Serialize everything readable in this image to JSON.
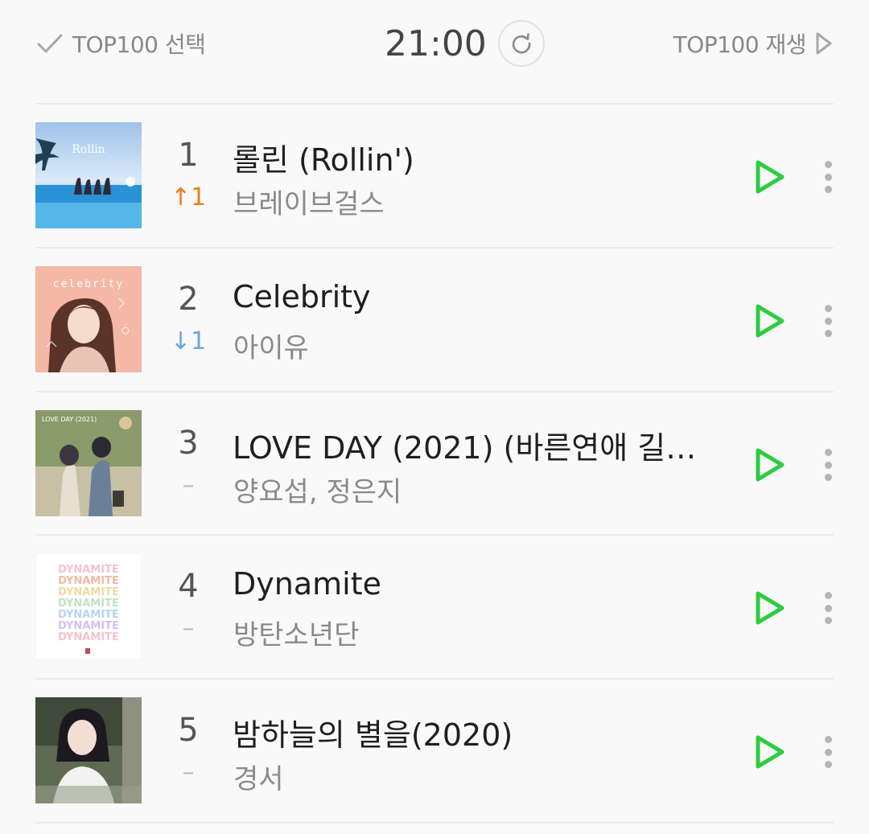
{
  "header": {
    "select_label": "TOP100 선택",
    "time": "21:00",
    "play_all_label": "TOP100 재생"
  },
  "songs": [
    {
      "rank": "1",
      "change": "↑1",
      "change_type": "up",
      "title": "롤린 (Rollin')",
      "artist": "브레이브걸스",
      "cover_text": "Rollin"
    },
    {
      "rank": "2",
      "change": "↓1",
      "change_type": "down",
      "title": "Celebrity",
      "artist": "아이유",
      "cover_text": "celebrity"
    },
    {
      "rank": "3",
      "change": "–",
      "change_type": "same",
      "title": "LOVE DAY (2021) (바른연애 길…",
      "artist": "양요섭, 정은지",
      "cover_text": "LOVE DAY (2021)"
    },
    {
      "rank": "4",
      "change": "–",
      "change_type": "same",
      "title": "Dynamite",
      "artist": "방탄소년단",
      "cover_text": "DYNAMITE"
    },
    {
      "rank": "5",
      "change": "–",
      "change_type": "same",
      "title": "밤하늘의 별을(2020)",
      "artist": "경서",
      "cover_text": ""
    }
  ],
  "colors": {
    "accent_play": "#2ecc40",
    "up": "#ee7d1a",
    "down": "#6aa5e0"
  },
  "icons": {
    "check": "check-icon",
    "refresh": "refresh-icon",
    "play_all": "play-outline-icon",
    "play": "play-icon",
    "more": "more-vertical-icon"
  }
}
